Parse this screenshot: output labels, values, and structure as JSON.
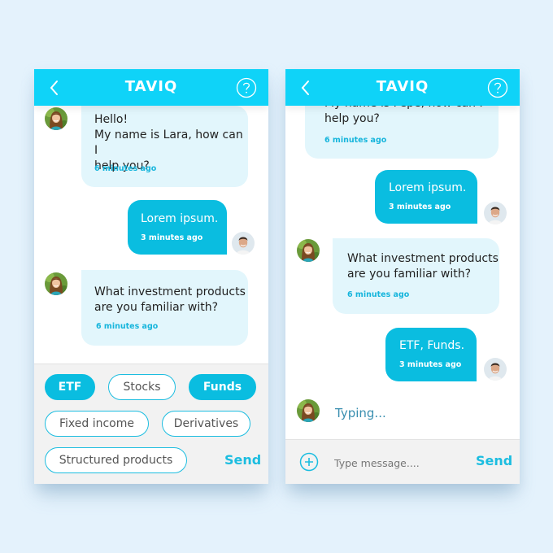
{
  "colors": {
    "brand": "#0fd3f8",
    "user_bubble": "#0abde0",
    "bot_bubble": "#e2f6fc",
    "timestamp": "#16b5dc",
    "page_background": "#e4f2fc"
  },
  "left_screen": {
    "header": {
      "title": "TAVIQ",
      "back_icon": "chevron-left-icon",
      "help_icon": "question-circle-icon"
    },
    "messages": [
      {
        "sender": "bot",
        "name": "Lara",
        "lines": [
          "Hello!",
          "My name is Lara, how can I",
          "help you?"
        ],
        "time": "6 minutes ago"
      },
      {
        "sender": "user",
        "lines": [
          "Lorem ipsum."
        ],
        "time": "3 minutes ago"
      },
      {
        "sender": "bot",
        "name": "Lara",
        "lines": [
          "What investment products",
          "are you familiar with?"
        ],
        "time": "6 minutes ago"
      }
    ],
    "options": [
      {
        "label": "ETF",
        "selected": true
      },
      {
        "label": "Stocks",
        "selected": false
      },
      {
        "label": "Funds",
        "selected": true
      },
      {
        "label": "Fixed income",
        "selected": false
      },
      {
        "label": "Derivatives",
        "selected": false
      },
      {
        "label": "Structured products",
        "selected": false
      }
    ],
    "send_label": "Send"
  },
  "right_screen": {
    "header": {
      "title": "TAVIQ",
      "back_icon": "chevron-left-icon",
      "help_icon": "question-circle-icon"
    },
    "messages": [
      {
        "sender": "bot",
        "name": "Pepe",
        "lines": [
          "My name is Pepe, how can I",
          "help you?"
        ],
        "time": "6 minutes ago"
      },
      {
        "sender": "user",
        "lines": [
          "Lorem ipsum."
        ],
        "time": "3 minutes ago"
      },
      {
        "sender": "bot",
        "name": "Lara",
        "lines": [
          "What investment products",
          "are you familiar with?"
        ],
        "time": "6 minutes ago"
      },
      {
        "sender": "user",
        "lines": [
          "ETF, Funds."
        ],
        "time": "3 minutes ago"
      }
    ],
    "typing_label": "Typing...",
    "input": {
      "placeholder": "Type message....",
      "value": ""
    },
    "add_icon": "plus-circle-icon",
    "send_label": "Send"
  }
}
